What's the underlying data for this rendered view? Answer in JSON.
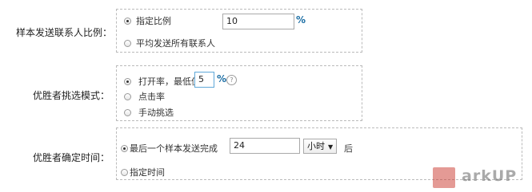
{
  "sample_ratio": {
    "label": "样本发送联系人比例：",
    "options": [
      {
        "label": "指定比例",
        "checked": true
      },
      {
        "label": "平均发送所有联系人",
        "checked": false
      }
    ],
    "value": "10",
    "unit": "%"
  },
  "winner_mode": {
    "label": "优胜者挑选模式：",
    "options": [
      {
        "label": "打开率，最低值",
        "checked": true
      },
      {
        "label": "点击率",
        "checked": false
      },
      {
        "label": "手动挑选",
        "checked": false
      }
    ],
    "value": "5",
    "unit": "%",
    "help_icon": "question-circle-icon",
    "help_symbol": "?"
  },
  "winner_time": {
    "label": "优胜者确定时间：",
    "options": [
      {
        "label": "最后一个样本发送完成",
        "checked": true
      },
      {
        "label": "指定时间",
        "checked": false
      }
    ],
    "value": "24",
    "unit_select": {
      "selected": "小时",
      "arrow": "▼"
    },
    "suffix": "后"
  },
  "watermark": {
    "text": "arkUP",
    "logo_icon": "arkup-logo-icon"
  }
}
